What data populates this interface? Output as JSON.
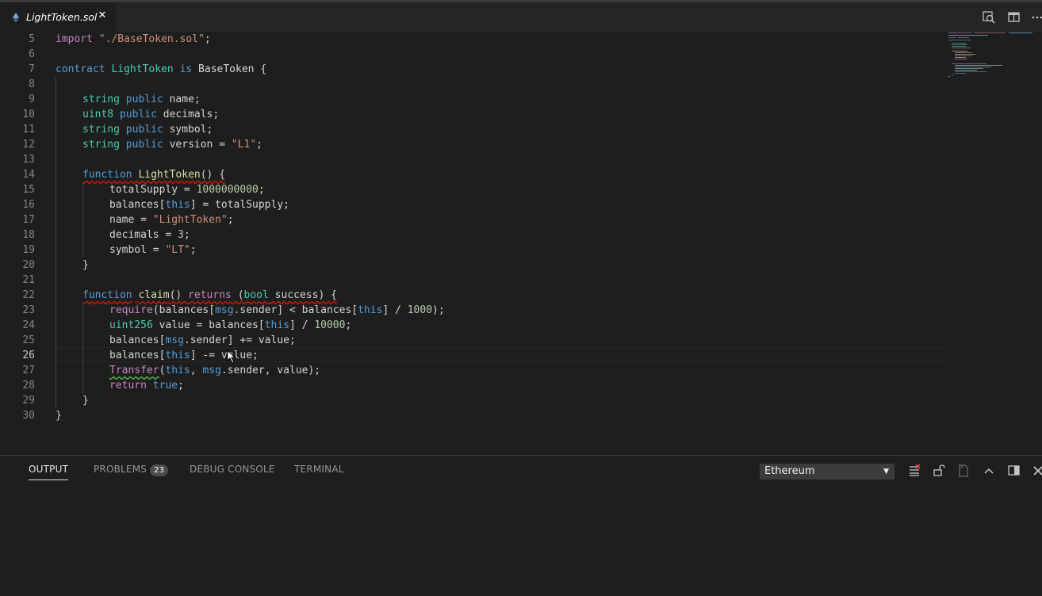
{
  "tab": {
    "filename": "LightToken.sol",
    "close_glyph": "✕"
  },
  "toolbar_icons": [
    "open-preview-icon",
    "split-editor-icon",
    "more-actions-icon"
  ],
  "editor": {
    "line_numbers": [
      "5",
      "6",
      "7",
      "8",
      "9",
      "10",
      "11",
      "12",
      "13",
      "14",
      "15",
      "16",
      "17",
      "18",
      "19",
      "20",
      "21",
      "22",
      "23",
      "24",
      "25",
      "26",
      "27",
      "28",
      "29",
      "30"
    ],
    "active_line": "26"
  },
  "panel": {
    "tabs": {
      "output": "OUTPUT",
      "problems": "PROBLEMS",
      "problems_count": "23",
      "debug_console": "DEBUG CONSOLE",
      "terminal": "TERMINAL"
    },
    "output_channel": "Ethereum",
    "icons": [
      "clear-output-icon",
      "lock-scroll-icon",
      "open-log-icon",
      "maximize-panel-icon",
      "toggle-panel-position-icon",
      "close-panel-icon"
    ]
  },
  "colors": {
    "keyword": "#569cd6",
    "control": "#c586c0",
    "string": "#ce9178",
    "number": "#b5cea8",
    "function": "#dcdcaa",
    "type": "#4ec9b0",
    "variable": "#9cdcfe",
    "error_squiggle": "#e51400",
    "warning_squiggle": "#4ec94e"
  },
  "code": {
    "l5": [
      "import",
      " ",
      "\"./BaseToken.sol\"",
      ";"
    ],
    "l7": [
      "contract",
      " ",
      "LightToken",
      " ",
      "is",
      " ",
      "BaseToken",
      " {"
    ],
    "l9": [
      "string",
      " ",
      "public",
      " name;"
    ],
    "l10": [
      "uint8",
      " ",
      "public",
      " decimals;"
    ],
    "l11": [
      "string",
      " ",
      "public",
      " symbol;"
    ],
    "l12": [
      "string",
      " ",
      "public",
      " version = ",
      "\"L1\"",
      ";"
    ],
    "l14": [
      "function",
      " ",
      "LightToken",
      "() {"
    ],
    "l15": [
      "totalSupply = ",
      "1000000000",
      ";"
    ],
    "l16": [
      "balances[",
      "this",
      "] = totalSupply;"
    ],
    "l17": [
      "name = ",
      "\"LightToken\"",
      ";"
    ],
    "l18": [
      "decimals = ",
      "3",
      ";"
    ],
    "l19": [
      "symbol = ",
      "\"LT\"",
      ";"
    ],
    "l20": [
      "}"
    ],
    "l22": [
      "function",
      " ",
      "claim",
      "() ",
      "returns",
      " (",
      "bool",
      " success) {"
    ],
    "l23": [
      "require",
      "(balances[",
      "msg",
      ".sender] < balances[",
      "this",
      "] / ",
      "1000",
      ");"
    ],
    "l24": [
      "uint256",
      " value = balances[",
      "this",
      "] / ",
      "10000",
      ";"
    ],
    "l25": [
      "balances[",
      "msg",
      ".sender] += value;"
    ],
    "l26": [
      "balances[",
      "this",
      "] -= value;"
    ],
    "l27": [
      "Transfer",
      "(",
      "this",
      ", ",
      "msg",
      ".sender, value);"
    ],
    "l28": [
      "return",
      " ",
      "true",
      ";"
    ],
    "l29": [
      "}"
    ],
    "l30": [
      "}"
    ]
  }
}
